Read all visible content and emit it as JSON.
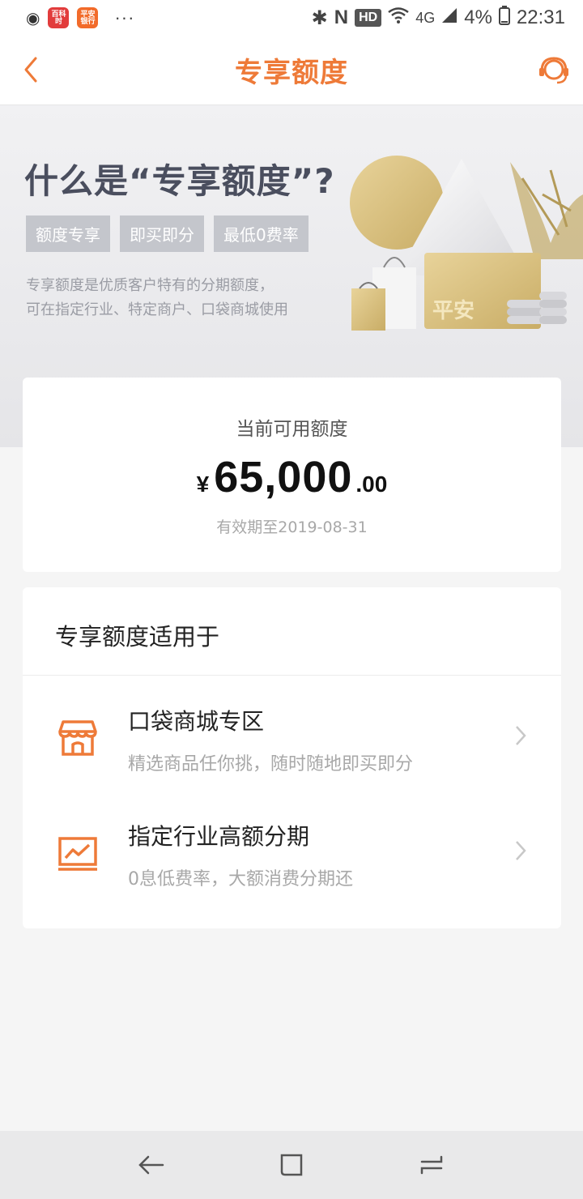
{
  "status_bar": {
    "left_icons": [
      "weibo-icon",
      "app-icon",
      "app-icon"
    ],
    "app1_label": "百科时",
    "app2_label": "平安银行",
    "more": "···",
    "hd": "HD",
    "network": "4G",
    "battery": "4%",
    "time": "22:31"
  },
  "nav": {
    "title": "专享额度",
    "back_icon": "chevron-left-icon",
    "service_icon": "headset-icon",
    "accent": "#ee7a38"
  },
  "banner": {
    "title": "什么是“专享额度”?",
    "tags": [
      "额度专享",
      "即买即分",
      "最低0费率"
    ],
    "desc_line1": "专享额度是优质客户特有的分期额度，",
    "desc_line2": "可在指定行业、特定商户、口袋商城使用",
    "art_card_text": "平安"
  },
  "credit": {
    "label": "当前可用额度",
    "currency": "¥",
    "amount_int": "65,000",
    "amount_dec": ".00",
    "expiry": "有效期至2019-08-31"
  },
  "usage": {
    "title": "专享额度适用于",
    "items": [
      {
        "icon": "store-icon",
        "title": "口袋商城专区",
        "subtitle": "精选商品任你挑，随时随地即买即分"
      },
      {
        "icon": "chart-monitor-icon",
        "title": "指定行业高额分期",
        "subtitle": "0息低费率，大额消费分期还"
      }
    ]
  },
  "system_nav": [
    "back-icon",
    "recents-icon",
    "overview-icon"
  ]
}
